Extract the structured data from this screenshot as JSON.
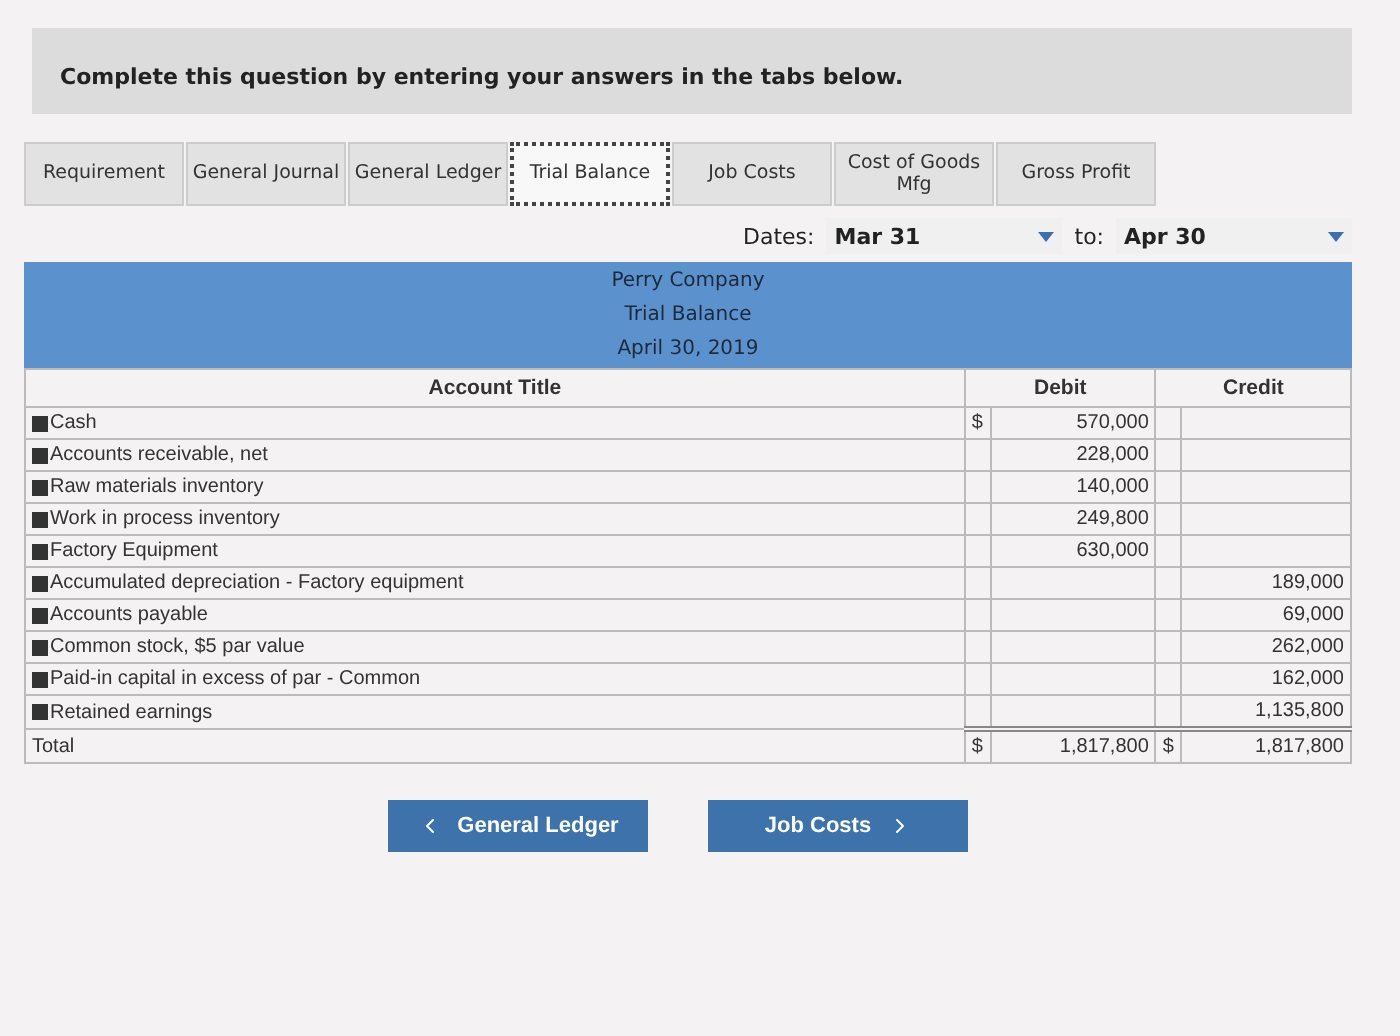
{
  "instruction": "Complete this question by entering your answers in the tabs below.",
  "tabs": [
    {
      "label": "Requirement",
      "selected": false
    },
    {
      "label": "General Journal",
      "selected": false
    },
    {
      "label": "General Ledger",
      "selected": false
    },
    {
      "label": "Trial Balance",
      "selected": true
    },
    {
      "label": "Job Costs",
      "selected": false
    },
    {
      "label": "Cost of Goods Mfg",
      "selected": false
    },
    {
      "label": "Gross Profit",
      "selected": false
    }
  ],
  "dates": {
    "label": "Dates:",
    "from": "Mar 31",
    "to_label": "to:",
    "to": "Apr 30"
  },
  "report_header": [
    "Perry Company",
    "Trial Balance",
    "April 30, 2019"
  ],
  "table": {
    "columns": [
      "Account Title",
      "Debit",
      "Credit"
    ],
    "rows": [
      {
        "kind": "account",
        "title": "Cash",
        "debit_symbol": "$",
        "debit": "570,000",
        "credit_symbol": "",
        "credit": ""
      },
      {
        "kind": "account",
        "title": "Accounts receivable, net",
        "debit_symbol": "",
        "debit": "228,000",
        "credit_symbol": "",
        "credit": ""
      },
      {
        "kind": "account",
        "title": "Raw materials inventory",
        "debit_symbol": "",
        "debit": "140,000",
        "credit_symbol": "",
        "credit": ""
      },
      {
        "kind": "account",
        "title": "Work in process inventory",
        "debit_symbol": "",
        "debit": "249,800",
        "credit_symbol": "",
        "credit": ""
      },
      {
        "kind": "account",
        "title": "Factory Equipment",
        "debit_symbol": "",
        "debit": "630,000",
        "credit_symbol": "",
        "credit": ""
      },
      {
        "kind": "account",
        "title": "Accumulated depreciation - Factory equipment",
        "debit_symbol": "",
        "debit": "",
        "credit_symbol": "",
        "credit": "189,000"
      },
      {
        "kind": "account",
        "title": "Accounts payable",
        "debit_symbol": "",
        "debit": "",
        "credit_symbol": "",
        "credit": "69,000"
      },
      {
        "kind": "account",
        "title": "Common stock, $5 par value",
        "debit_symbol": "",
        "debit": "",
        "credit_symbol": "",
        "credit": "262,000"
      },
      {
        "kind": "account",
        "title": "Paid-in capital in excess of par - Common",
        "debit_symbol": "",
        "debit": "",
        "credit_symbol": "",
        "credit": "162,000"
      },
      {
        "kind": "account",
        "title": "Retained earnings",
        "debit_symbol": "",
        "debit": "",
        "credit_symbol": "",
        "credit": "1,135,800"
      },
      {
        "kind": "total",
        "title": "Total",
        "debit_symbol": "$",
        "debit": "1,817,800",
        "credit_symbol": "$",
        "credit": "1,817,800"
      }
    ]
  },
  "nav_buttons": [
    {
      "kind": "prev",
      "label": "General Ledger"
    },
    {
      "kind": "next",
      "label": "Job Costs"
    }
  ]
}
